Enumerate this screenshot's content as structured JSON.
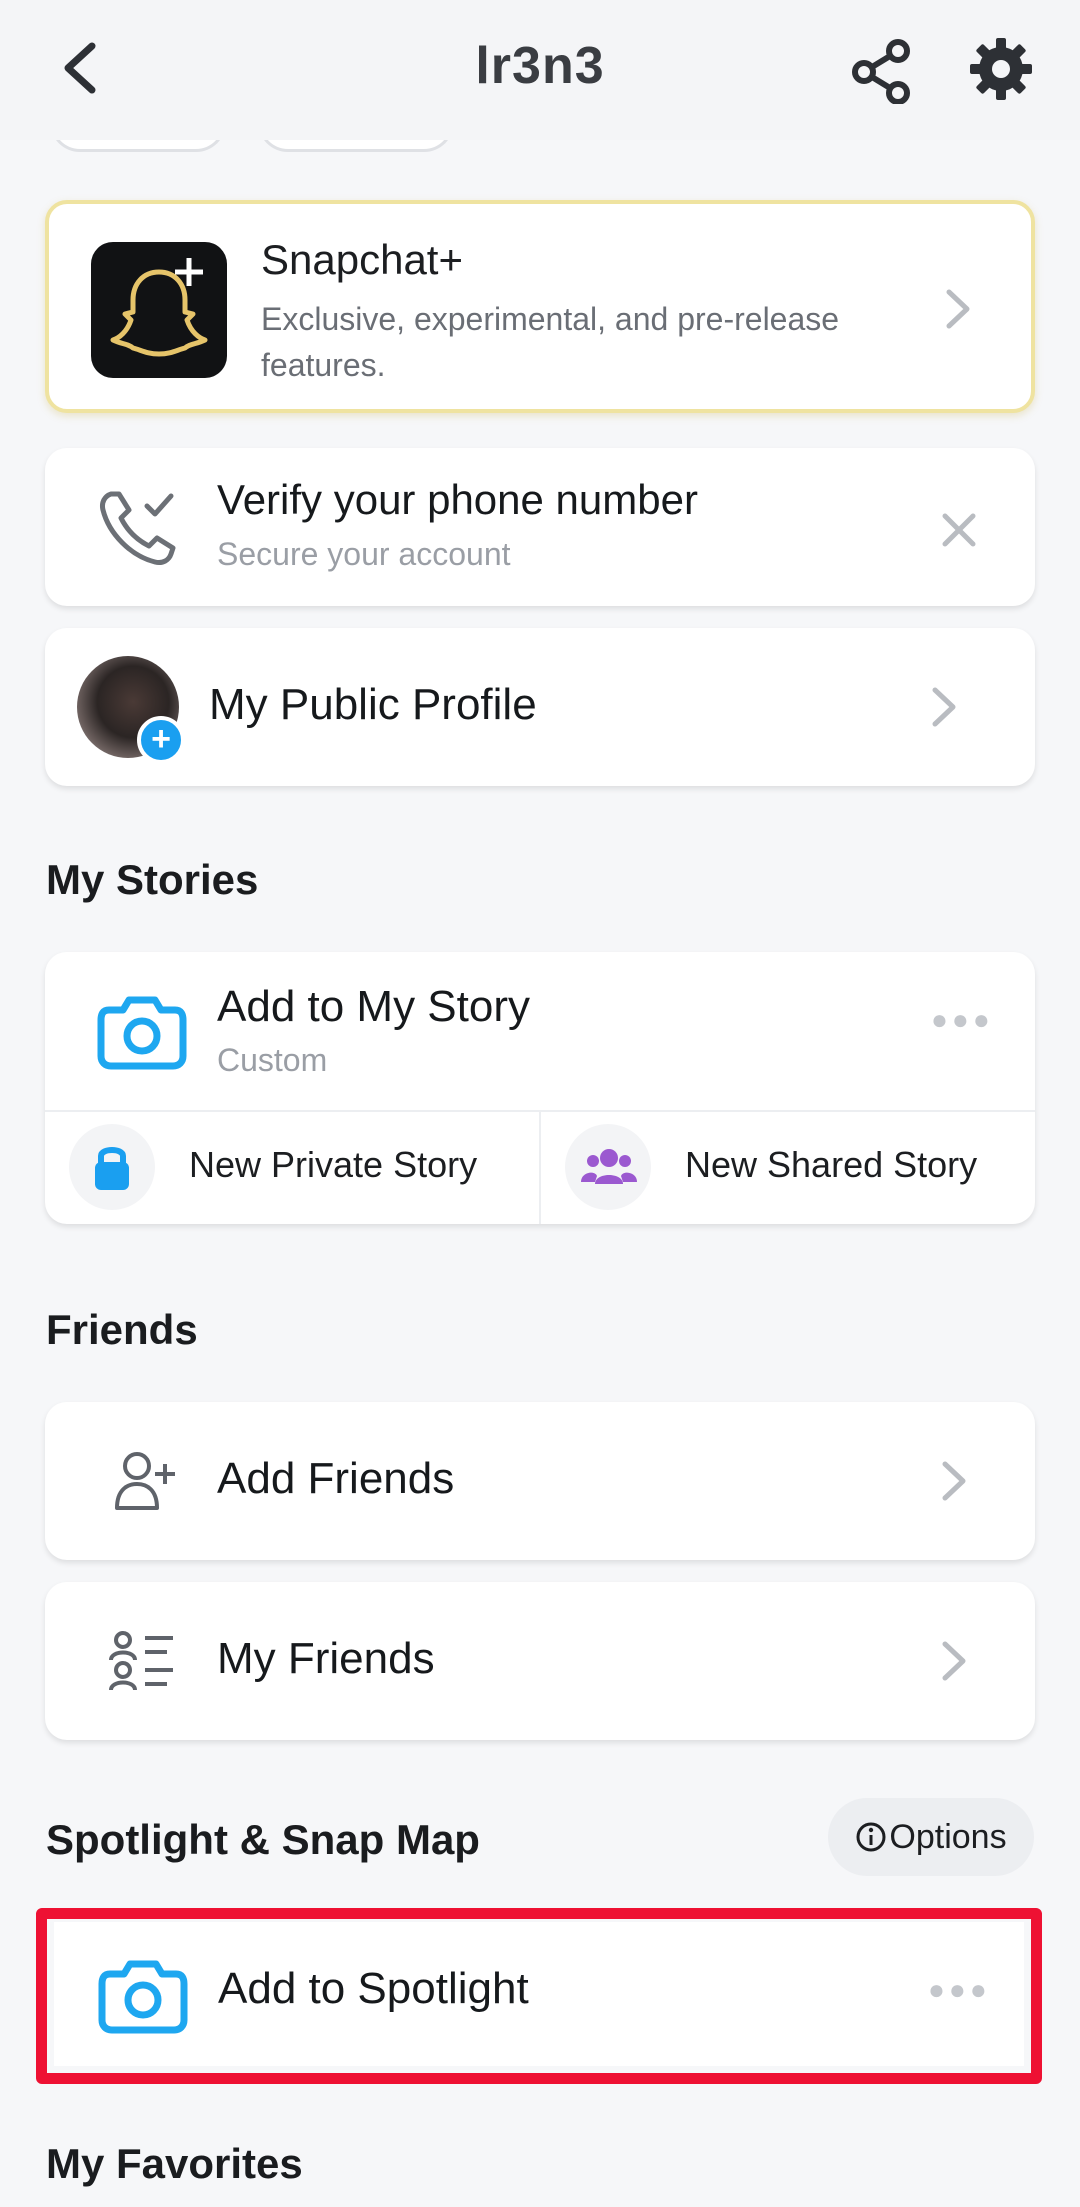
{
  "header": {
    "title": "lr3n3"
  },
  "snapchat_plus": {
    "name": "Snapchat+",
    "description": "Exclusive, experimental, and pre-release features."
  },
  "verify_phone": {
    "title": "Verify your phone number",
    "subtitle": "Secure your account"
  },
  "public_profile": {
    "label": "My Public Profile"
  },
  "sections": {
    "my_stories": "My Stories",
    "friends": "Friends",
    "spotlight_map": "Spotlight & Snap Map",
    "my_favorites": "My Favorites"
  },
  "stories": {
    "add_label": "Add to My Story",
    "add_sub": "Custom",
    "private_label": "New Private Story",
    "shared_label": "New Shared Story"
  },
  "friends": {
    "add_label": "Add Friends",
    "my_label": "My Friends"
  },
  "spotlight": {
    "options_label": "Options",
    "add_label": "Add to Spotlight"
  },
  "colors": {
    "accent_blue": "#1a9ff0",
    "purple": "#9b59d0",
    "highlight_red": "#ee1133",
    "gold": "#efe3a0"
  }
}
